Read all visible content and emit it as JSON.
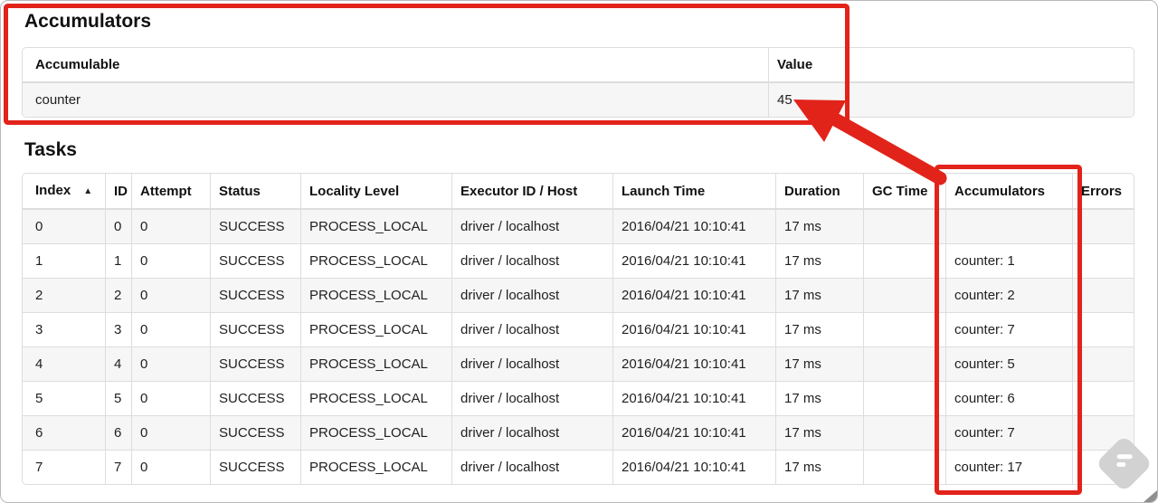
{
  "annotation_color": "#e2231a",
  "stripe_color": "#f6f6f6",
  "border_color": "#dddddd",
  "accumulators_section": {
    "title": "Accumulators",
    "table": {
      "headers": [
        "Accumulable",
        "Value"
      ],
      "rows": [
        {
          "accumulable": "counter",
          "value": "45"
        }
      ]
    }
  },
  "tasks_section": {
    "title": "Tasks",
    "table": {
      "headers": [
        "Index",
        "ID",
        "Attempt",
        "Status",
        "Locality Level",
        "Executor ID / Host",
        "Launch Time",
        "Duration",
        "GC Time",
        "Accumulators",
        "Errors"
      ],
      "sort_indicator": "▲",
      "rows": [
        {
          "index": "0",
          "id": "0",
          "attempt": "0",
          "status": "SUCCESS",
          "locality_level": "PROCESS_LOCAL",
          "executor_id_host": "driver / localhost",
          "launch_time": "2016/04/21 10:10:41",
          "duration": "17 ms",
          "gc_time": "",
          "accumulators": "",
          "errors": ""
        },
        {
          "index": "1",
          "id": "1",
          "attempt": "0",
          "status": "SUCCESS",
          "locality_level": "PROCESS_LOCAL",
          "executor_id_host": "driver / localhost",
          "launch_time": "2016/04/21 10:10:41",
          "duration": "17 ms",
          "gc_time": "",
          "accumulators": "counter: 1",
          "errors": ""
        },
        {
          "index": "2",
          "id": "2",
          "attempt": "0",
          "status": "SUCCESS",
          "locality_level": "PROCESS_LOCAL",
          "executor_id_host": "driver / localhost",
          "launch_time": "2016/04/21 10:10:41",
          "duration": "17 ms",
          "gc_time": "",
          "accumulators": "counter: 2",
          "errors": ""
        },
        {
          "index": "3",
          "id": "3",
          "attempt": "0",
          "status": "SUCCESS",
          "locality_level": "PROCESS_LOCAL",
          "executor_id_host": "driver / localhost",
          "launch_time": "2016/04/21 10:10:41",
          "duration": "17 ms",
          "gc_time": "",
          "accumulators": "counter: 7",
          "errors": ""
        },
        {
          "index": "4",
          "id": "4",
          "attempt": "0",
          "status": "SUCCESS",
          "locality_level": "PROCESS_LOCAL",
          "executor_id_host": "driver / localhost",
          "launch_time": "2016/04/21 10:10:41",
          "duration": "17 ms",
          "gc_time": "",
          "accumulators": "counter: 5",
          "errors": ""
        },
        {
          "index": "5",
          "id": "5",
          "attempt": "0",
          "status": "SUCCESS",
          "locality_level": "PROCESS_LOCAL",
          "executor_id_host": "driver / localhost",
          "launch_time": "2016/04/21 10:10:41",
          "duration": "17 ms",
          "gc_time": "",
          "accumulators": "counter: 6",
          "errors": ""
        },
        {
          "index": "6",
          "id": "6",
          "attempt": "0",
          "status": "SUCCESS",
          "locality_level": "PROCESS_LOCAL",
          "executor_id_host": "driver / localhost",
          "launch_time": "2016/04/21 10:10:41",
          "duration": "17 ms",
          "gc_time": "",
          "accumulators": "counter: 7",
          "errors": ""
        },
        {
          "index": "7",
          "id": "7",
          "attempt": "0",
          "status": "SUCCESS",
          "locality_level": "PROCESS_LOCAL",
          "executor_id_host": "driver / localhost",
          "launch_time": "2016/04/21 10:10:41",
          "duration": "17 ms",
          "gc_time": "",
          "accumulators": "counter: 17",
          "errors": ""
        }
      ]
    }
  }
}
